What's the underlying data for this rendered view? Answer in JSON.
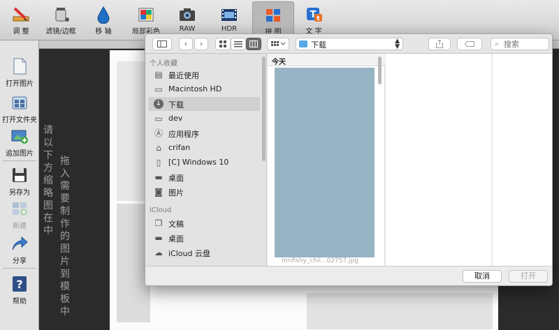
{
  "toolbar": {
    "items": [
      {
        "label": "调 整",
        "icon": "pencil-ruler-icon"
      },
      {
        "label": "滤镜/边框",
        "icon": "paint-bucket-icon"
      },
      {
        "label": "移 轴",
        "icon": "water-drop-icon"
      },
      {
        "label": "局部彩色",
        "icon": "palette-icon"
      },
      {
        "label": "RAW",
        "icon": "camera-icon"
      },
      {
        "label": "HDR",
        "icon": "film-icon"
      },
      {
        "label": "拼 图",
        "icon": "collage-icon"
      },
      {
        "label": "文 字",
        "icon": "text-icon"
      }
    ],
    "active_index": 6
  },
  "sidebar": {
    "items": [
      {
        "label": "打开图片",
        "icon": "open-image-icon",
        "enabled": true
      },
      {
        "label": "打开文件夹",
        "icon": "open-folder-icon",
        "enabled": true
      },
      {
        "label": "追加图片",
        "icon": "append-image-icon",
        "enabled": true
      },
      {
        "label": "另存为",
        "icon": "save-icon",
        "enabled": true
      },
      {
        "label": "新建",
        "icon": "new-collage-icon",
        "enabled": false
      },
      {
        "label": "分享",
        "icon": "share-icon",
        "enabled": true
      },
      {
        "label": "帮助",
        "icon": "help-icon",
        "enabled": true
      }
    ]
  },
  "canvas": {
    "hint_col1": "请以下方缩略图在中",
    "hint_col2": "拖入需要制作的图片到模板中"
  },
  "dialog": {
    "path": "下载",
    "search_placeholder": "搜索",
    "sections": {
      "favorites": "个人收藏",
      "icloud": "iCloud"
    },
    "favorites": [
      {
        "label": "最近使用",
        "icon": "recent-icon"
      },
      {
        "label": "Macintosh HD",
        "icon": "disk-icon"
      },
      {
        "label": "下载",
        "icon": "downloads-icon",
        "selected": true
      },
      {
        "label": "dev",
        "icon": "folder-icon"
      },
      {
        "label": "应用程序",
        "icon": "applications-icon"
      },
      {
        "label": "crifan",
        "icon": "home-icon"
      },
      {
        "label": "[C] Windows 10",
        "icon": "document-icon"
      },
      {
        "label": "桌面",
        "icon": "desktop-icon"
      },
      {
        "label": "图片",
        "icon": "pictures-icon"
      }
    ],
    "icloud": [
      {
        "label": "文稿",
        "icon": "documents-icon"
      },
      {
        "label": "桌面",
        "icon": "desktop-icon"
      },
      {
        "label": "iCloud 云盘",
        "icon": "cloud-icon"
      }
    ],
    "column_header": "今天",
    "truncated_text": "mnfishy_chii...02757.jpg",
    "cancel_label": "取消",
    "open_label": "打开"
  }
}
